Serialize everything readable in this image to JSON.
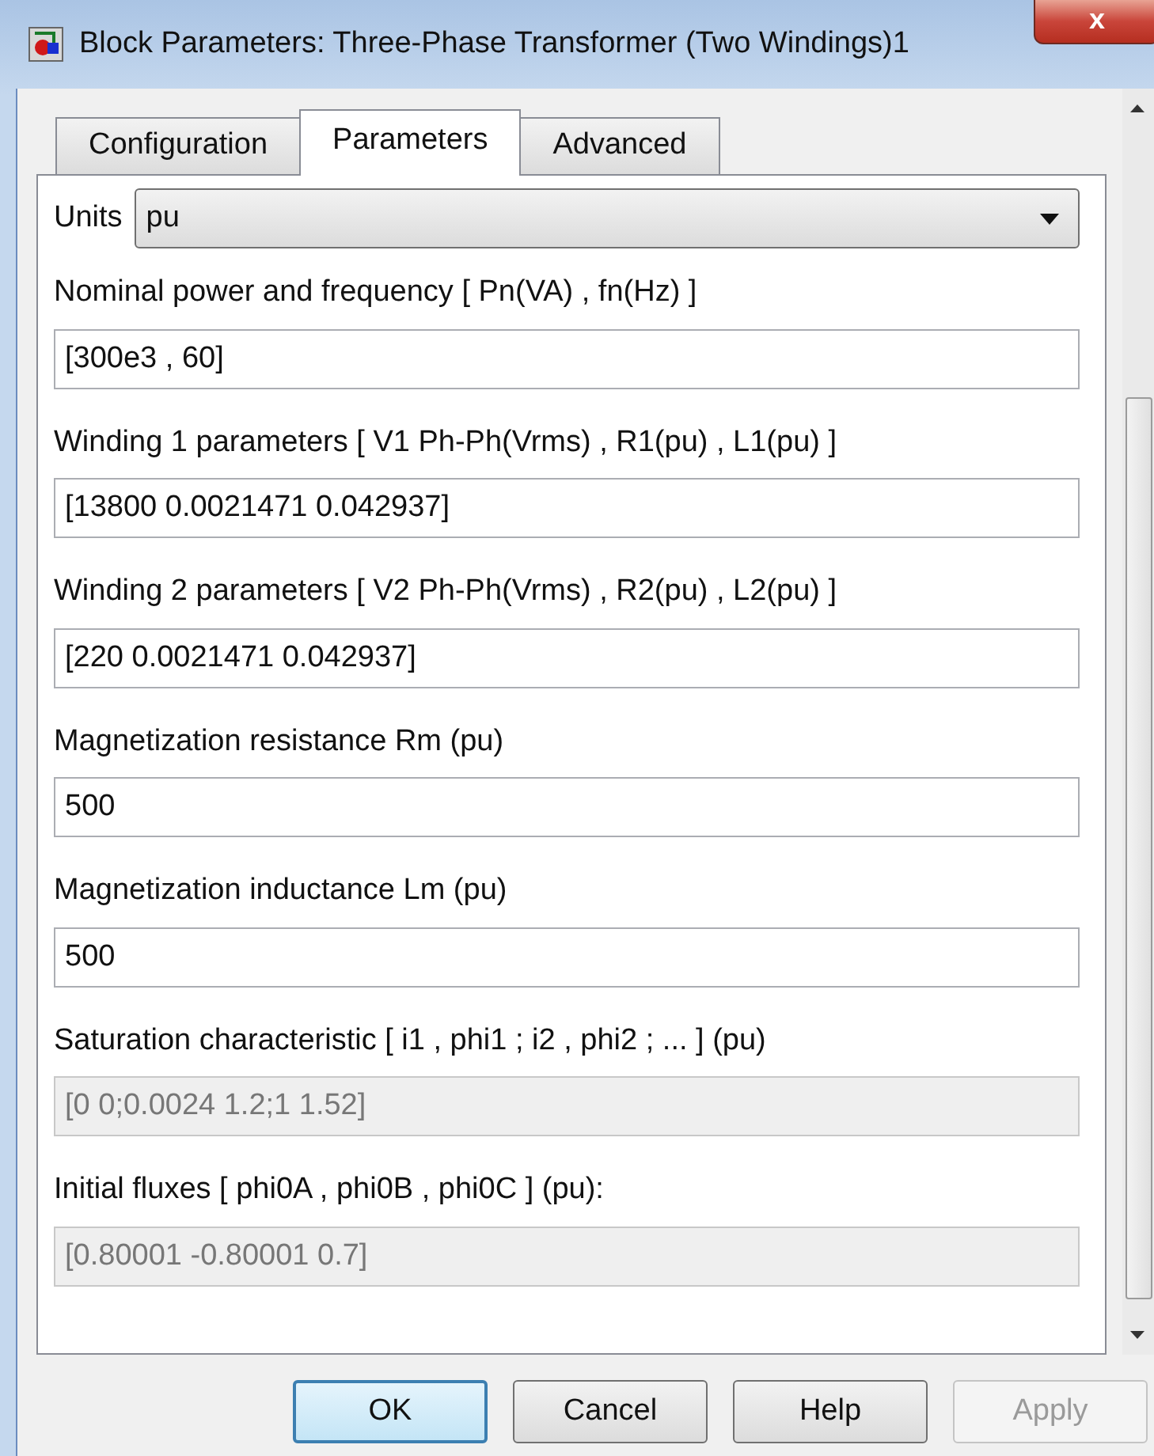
{
  "window": {
    "title": "Block Parameters: Three-Phase Transformer (Two Windings)1",
    "close": "x"
  },
  "tabs": [
    {
      "label": "Configuration",
      "selected": false
    },
    {
      "label": "Parameters",
      "selected": true
    },
    {
      "label": "Advanced",
      "selected": false
    }
  ],
  "units": {
    "label": "Units",
    "value": "pu"
  },
  "fields": [
    {
      "label": "Nominal power and frequency  [ Pn(VA) , fn(Hz) ]",
      "value": "[300e3 , 60]",
      "disabled": false
    },
    {
      "label": "Winding 1 parameters [ V1 Ph-Ph(Vrms) , R1(pu) , L1(pu) ]",
      "value": "[13800 0.0021471 0.042937]",
      "disabled": false
    },
    {
      "label": "Winding 2 parameters [ V2 Ph-Ph(Vrms) , R2(pu) , L2(pu) ]",
      "value": "[220 0.0021471 0.042937]",
      "disabled": false
    },
    {
      "label": "Magnetization resistance  Rm (pu)",
      "value": "500",
      "disabled": false
    },
    {
      "label": "Magnetization inductance  Lm (pu)",
      "value": "500",
      "disabled": false
    },
    {
      "label": "Saturation characteristic [ i1 ,  phi1 ;  i2 , phi2 ; ... ] (pu)",
      "value": "[0 0;0.0024 1.2;1 1.52]",
      "disabled": true
    },
    {
      "label": "Initial fluxes [ phi0A , phi0B , phi0C ] (pu):",
      "value": "[0.80001 -0.80001 0.7]",
      "disabled": true
    }
  ],
  "buttons": [
    {
      "label": "OK",
      "default": true,
      "disabled": false
    },
    {
      "label": "Cancel",
      "default": false,
      "disabled": false
    },
    {
      "label": "Help",
      "default": false,
      "disabled": false
    },
    {
      "label": "Apply",
      "default": false,
      "disabled": true
    }
  ]
}
